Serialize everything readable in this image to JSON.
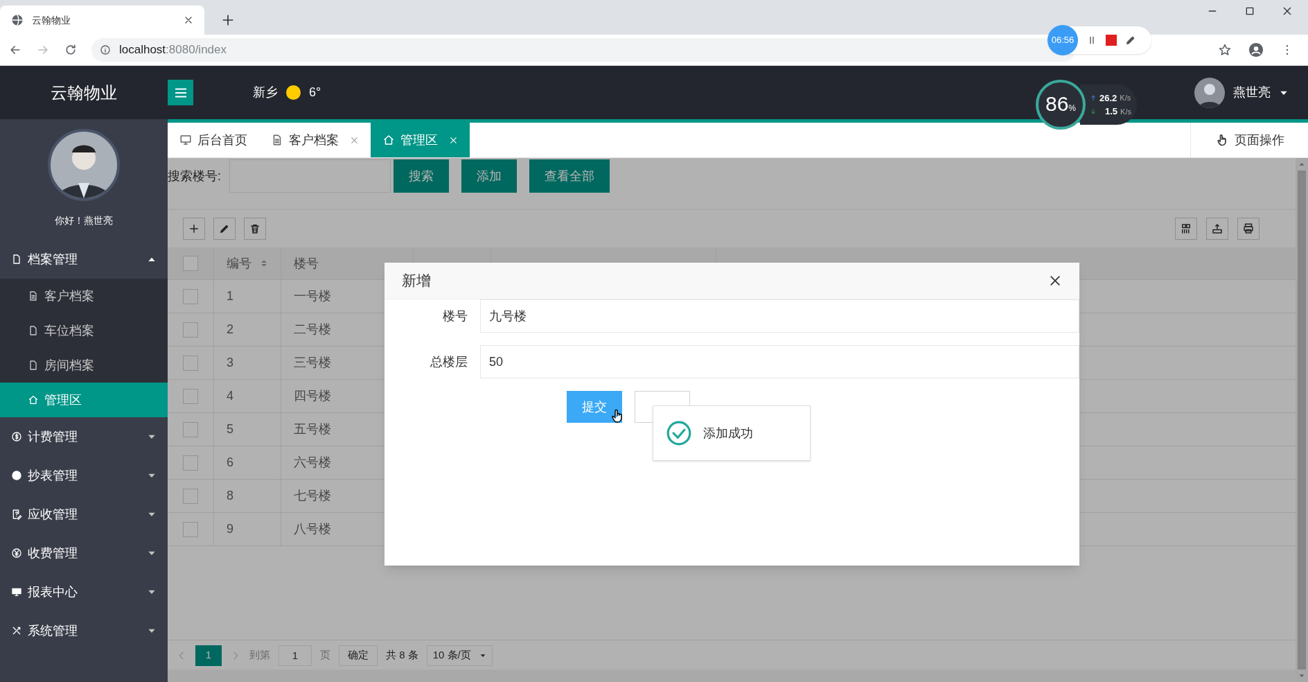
{
  "browser": {
    "tab_title": "云翰物业",
    "url_host": "localhost",
    "url_path": ":8080/index",
    "recorder_time": "06:56"
  },
  "header": {
    "logo": "云翰物业",
    "city": "新乡",
    "temperature": "6°",
    "speed": {
      "percent": "86",
      "percent_unit": "%",
      "up": "26.2",
      "up_unit": "K/s",
      "down": "1.5",
      "down_unit": "K/s"
    },
    "user": "燕世亮"
  },
  "sidebar": {
    "greeting": "你好！燕世亮",
    "menu": [
      {
        "label": "档案管理",
        "expanded": true,
        "selected": false,
        "children": [
          {
            "label": "客户档案",
            "selected": false
          },
          {
            "label": "车位档案",
            "selected": false
          },
          {
            "label": "房间档案",
            "selected": false
          },
          {
            "label": "管理区",
            "selected": true
          }
        ]
      },
      {
        "label": "计费管理",
        "expanded": false,
        "selected": false
      },
      {
        "label": "抄表管理",
        "expanded": false,
        "selected": false
      },
      {
        "label": "应收管理",
        "expanded": false,
        "selected": false
      },
      {
        "label": "收费管理",
        "expanded": false,
        "selected": false
      },
      {
        "label": "报表中心",
        "expanded": false,
        "selected": false
      },
      {
        "label": "系统管理",
        "expanded": false,
        "selected": false
      }
    ]
  },
  "tabs": [
    {
      "label": "后台首页",
      "closable": false,
      "selected": false
    },
    {
      "label": "客户档案",
      "closable": true,
      "selected": false
    },
    {
      "label": "管理区",
      "closable": true,
      "selected": true
    }
  ],
  "page_action": "页面操作",
  "search": {
    "label": "搜索楼号:",
    "buttons": [
      "搜索",
      "添加",
      "查看全部"
    ]
  },
  "table": {
    "all_checked": false,
    "columns": [
      "编号",
      "楼号"
    ],
    "rows": [
      {
        "cells": [
          "1",
          "一号楼"
        ],
        "checked": false
      },
      {
        "cells": [
          "2",
          "二号楼"
        ],
        "checked": false
      },
      {
        "cells": [
          "3",
          "三号楼"
        ],
        "checked": false
      },
      {
        "cells": [
          "4",
          "四号楼"
        ],
        "checked": false
      },
      {
        "cells": [
          "5",
          "五号楼"
        ],
        "checked": false
      },
      {
        "cells": [
          "6",
          "六号楼"
        ],
        "checked": false
      },
      {
        "cells": [
          "8",
          "七号楼"
        ],
        "checked": false
      },
      {
        "cells": [
          "9",
          "八号楼"
        ],
        "checked": false
      }
    ]
  },
  "pagination": {
    "current": "1",
    "goto_label": "到第",
    "goto_value": "1",
    "page_label": "页",
    "confirm": "确定",
    "total": "共 8 条",
    "page_size": "10 条/页"
  },
  "dialog": {
    "title": "新增",
    "fields": [
      {
        "label": "楼号",
        "value": "九号楼"
      },
      {
        "label": "总楼层",
        "value": "50"
      }
    ],
    "submit": "提交"
  },
  "toast": {
    "message": "添加成功"
  }
}
